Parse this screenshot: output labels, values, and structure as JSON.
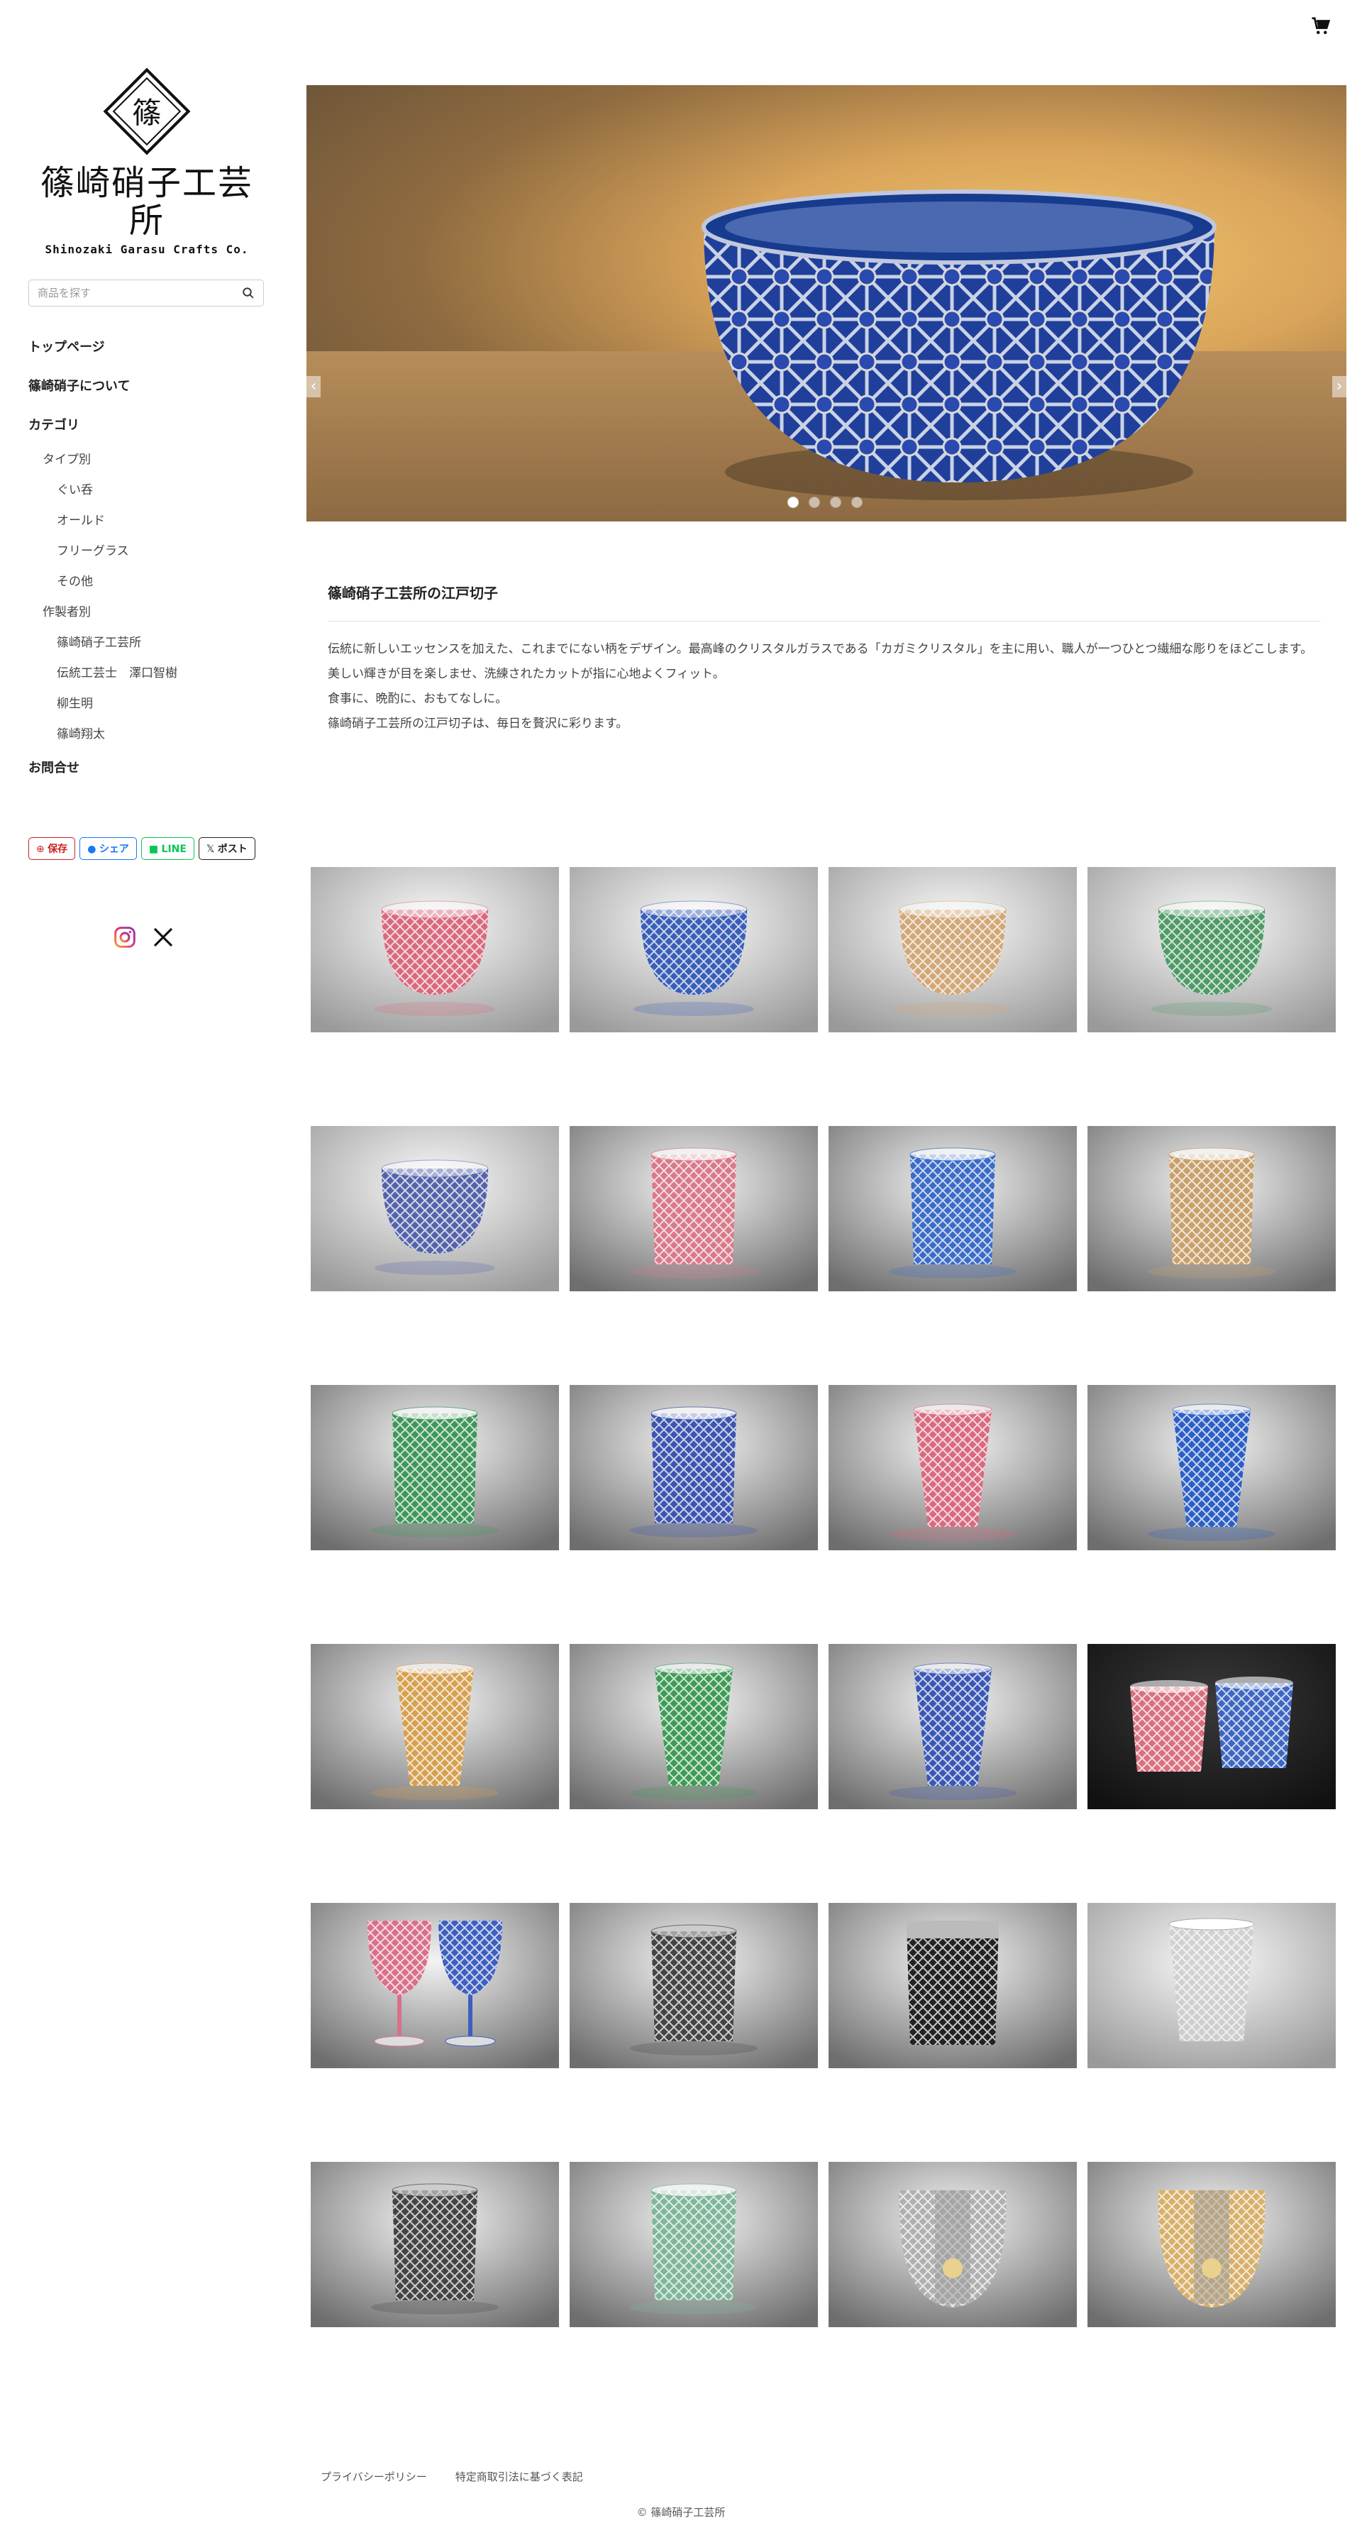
{
  "header": {
    "cart_icon": "cart-icon"
  },
  "logo": {
    "name": "篠崎硝子工芸所",
    "subtitle": "Shinozaki Garasu Crafts Co.",
    "mark_letter": "篠"
  },
  "search": {
    "placeholder": "商品を探す",
    "icon": "search-icon"
  },
  "nav": {
    "top": "トップページ",
    "about": "篠崎硝子について",
    "category": "カテゴリ",
    "type_label": "タイプ別",
    "types": [
      "ぐい呑",
      "オールド",
      "フリーグラス",
      "その他"
    ],
    "maker_label": "作製者別",
    "makers": [
      "篠崎硝子工芸所",
      "伝統工芸士　澤口智樹",
      "柳生明",
      "篠崎翔太"
    ],
    "contact": "お問合せ"
  },
  "share": {
    "pin": "保存",
    "fb": "シェア",
    "line": "LINE",
    "x": "ポスト"
  },
  "social": [
    "instagram-icon",
    "x-icon"
  ],
  "hero": {
    "slide_count": 4,
    "active_slide": 1
  },
  "about": {
    "title": "篠崎硝子工芸所の江戸切子",
    "body": "伝統に新しいエッセンスを加えた、これまでにない柄をデザイン。最高峰のクリスタルガラスである「カガミクリスタル」を主に用い、職人が一つひとつ繊細な彫りをほどこします。\n美しい輝きが目を楽しませ、洗練されたカットが指に心地よくフィット。\n食事に、晩酌に、おもてなしに。\n篠崎硝子工芸所の江戸切子は、毎日を贅沢に彩ります。"
  },
  "products": [
    {
      "shape": "bowl",
      "color": "#d96a7e",
      "bg": "light"
    },
    {
      "shape": "bowl",
      "color": "#3a5fb8",
      "bg": "light"
    },
    {
      "shape": "bowl",
      "color": "#d2a878",
      "bg": "light"
    },
    {
      "shape": "bowl",
      "color": "#4f9a66",
      "bg": "light"
    },
    {
      "shape": "bowl",
      "color": "#5563aa",
      "bg": "light"
    },
    {
      "shape": "old",
      "color": "#d97a8a",
      "bg": "dark"
    },
    {
      "shape": "old",
      "color": "#3b6cc7",
      "bg": "dark"
    },
    {
      "shape": "old",
      "color": "#c9a06b",
      "bg": "dark"
    },
    {
      "shape": "old",
      "color": "#3f9659",
      "bg": "dark"
    },
    {
      "shape": "old",
      "color": "#3d55b0",
      "bg": "dark"
    },
    {
      "shape": "tumbler",
      "color": "#d96a80",
      "bg": "dark"
    },
    {
      "shape": "tumbler",
      "color": "#2c5fc6",
      "bg": "dark"
    },
    {
      "shape": "tumbler",
      "color": "#d6a04f",
      "bg": "dark"
    },
    {
      "shape": "tumbler",
      "color": "#3e9a55",
      "bg": "dark"
    },
    {
      "shape": "tumbler",
      "color": "#3a57b5",
      "bg": "dark"
    },
    {
      "shape": "pair",
      "color": "#d9707f",
      "color2": "#3f66c2",
      "bg": "black"
    },
    {
      "shape": "wine",
      "color": "#d9708a",
      "color2": "#3e5fc0",
      "bg": "dark"
    },
    {
      "shape": "silver",
      "color": "#8a8a8a",
      "bg": "dark"
    },
    {
      "shape": "silvertall",
      "color": "#6a6a6a",
      "bg": "dark"
    },
    {
      "shape": "clear",
      "color": "#e0e0e0",
      "bg": "light"
    },
    {
      "shape": "silver",
      "color": "#777777",
      "bg": "dark"
    },
    {
      "shape": "old",
      "color": "#7fb69a",
      "bg": "dark"
    },
    {
      "shape": "gold",
      "color": "#b0b0b0",
      "bg": "dark"
    },
    {
      "shape": "gold",
      "color": "#d8b06a",
      "bg": "dark"
    }
  ],
  "footer": {
    "privacy": "プライバシーポリシー",
    "law": "特定商取引法に基づく表記",
    "copyright": "© 篠崎硝子工芸所"
  }
}
